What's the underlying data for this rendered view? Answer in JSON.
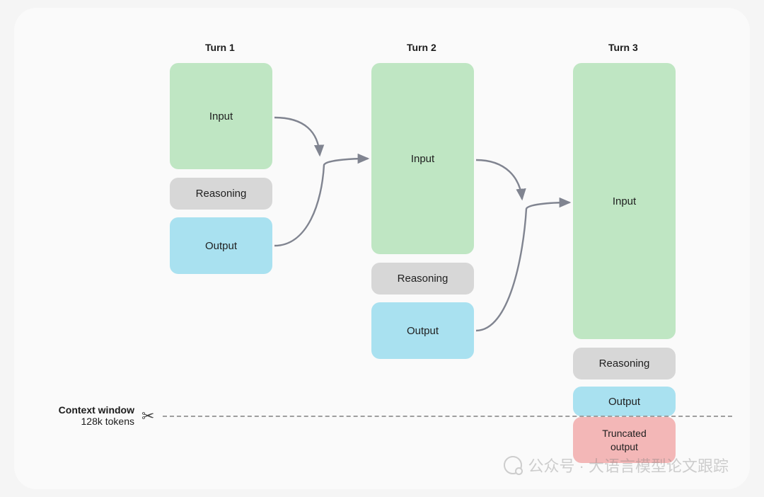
{
  "headings": {
    "t1": "Turn 1",
    "t2": "Turn 2",
    "t3": "Turn 3"
  },
  "labels": {
    "input": "Input",
    "reasoning": "Reasoning",
    "output": "Output",
    "truncated": "Truncated\noutput"
  },
  "context": {
    "title": "Context window",
    "subtitle": "128k tokens"
  },
  "watermark": "公众号 · 大语言模型论文跟踪",
  "colors": {
    "input": "#bfe6c3",
    "reasoning": "#d7d7d7",
    "output": "#a9e1f0",
    "truncated": "#f3b7b7",
    "arrow": "#808490"
  }
}
